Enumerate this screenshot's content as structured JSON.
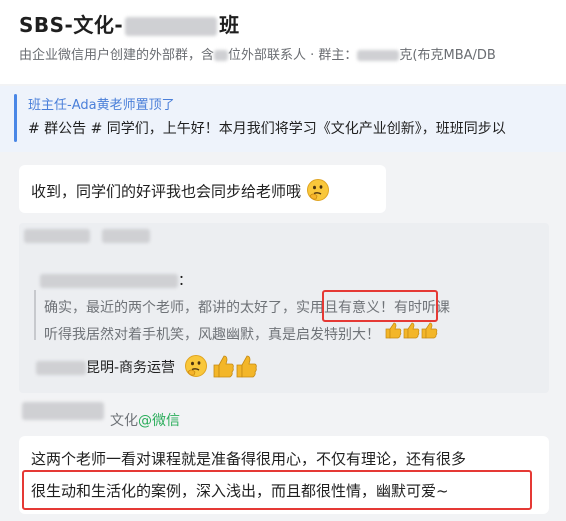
{
  "header": {
    "title_prefix": "SBS-文化-",
    "title_suffix": "班",
    "subtitle_a": "由企业微信用户创建的外部群，含",
    "subtitle_b": "位外部联系人 · 群主：",
    "subtitle_c": "克(布克MBA/DB"
  },
  "notice": {
    "pinned_by": "班主任-Ada黄老师置顶了",
    "content": "# 群公告 # 同学们，上午好！本月我们将学习《文化产业创新》，班班同步以"
  },
  "messages": [
    {
      "text": "收到，同学们的好评我也会同步给老师哦",
      "emoji": "thinking-face-icon"
    },
    {
      "sender_suffix": "：",
      "quote_a": "确实，最近的两个老师，都讲的太好了，",
      "quote_highlight": "实用且有意义！",
      "quote_b": "有时听课",
      "quote_line2": "听得我居然对着手机笑，风趣幽默，真是启发特别大！",
      "author_name": "昆明-商务运营"
    },
    {
      "sender_name": "文化",
      "sender_source": "@微信",
      "line1": "这两个老师一看对课程就是准备得很用心，不仅有理论，还有很多",
      "line2": "很生动和生活化的案例，深入浅出，而且都很性情，幽默可爱~"
    }
  ],
  "colors": {
    "accent_blue": "#4a87e6",
    "wechat_green": "#2bad5b",
    "highlight_red": "#e53935"
  }
}
